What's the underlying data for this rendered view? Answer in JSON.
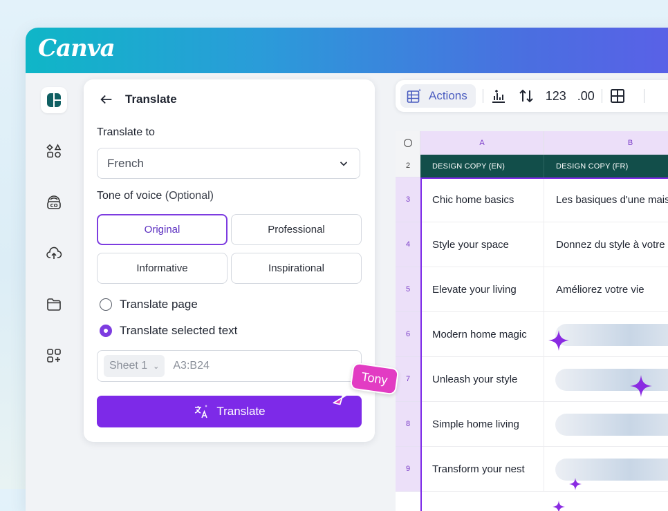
{
  "app": {
    "logo": "Canva"
  },
  "rail": {
    "items": [
      {
        "icon": "sheets-icon",
        "active": true
      },
      {
        "icon": "elements-icon"
      },
      {
        "icon": "brand-icon"
      },
      {
        "icon": "upload-icon"
      },
      {
        "icon": "folder-icon"
      },
      {
        "icon": "apps-icon"
      }
    ]
  },
  "panel": {
    "title": "Translate",
    "translate_to_label": "Translate to",
    "language_value": "French",
    "tone_label": "Tone of voice",
    "tone_optional": "(Optional)",
    "tones": [
      "Original",
      "Professional",
      "Informative",
      "Inspirational"
    ],
    "selected_tone": "Original",
    "radio_page": "Translate page",
    "radio_selected": "Translate selected text",
    "sheet_name": "Sheet 1",
    "range_value": "A3:B24",
    "button_label": "Translate"
  },
  "cursor": {
    "name": "Tony",
    "color": "#e23cc3"
  },
  "toolbar": {
    "actions_label": "Actions",
    "number_format": "123",
    "decimal_format": ".00"
  },
  "sheet": {
    "columns": [
      "A",
      "B"
    ],
    "header_row_number": "2",
    "headers": [
      "DESIGN COPY (EN)",
      "DESIGN COPY (FR)"
    ],
    "rows": [
      {
        "num": "3",
        "en": "Chic home basics",
        "fr": "Les basiques d'une mais"
      },
      {
        "num": "4",
        "en": "Style your space",
        "fr": "Donnez du style à votre"
      },
      {
        "num": "5",
        "en": "Elevate your living",
        "fr": "Améliorez votre vie"
      },
      {
        "num": "6",
        "en": "Modern home magic",
        "fr": ""
      },
      {
        "num": "7",
        "en": "Unleash your style",
        "fr": ""
      },
      {
        "num": "8",
        "en": "Simple home living",
        "fr": ""
      },
      {
        "num": "9",
        "en": "Transform your nest",
        "fr": ""
      }
    ]
  },
  "colors": {
    "accent": "#7d2ae8",
    "header_bg": "#124e4a",
    "sparkle": "#8a2be2"
  }
}
